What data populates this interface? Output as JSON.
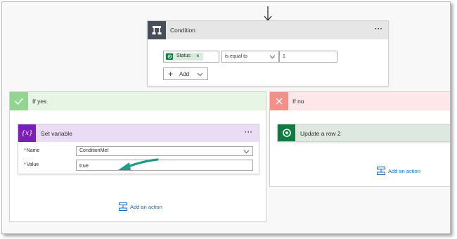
{
  "condition": {
    "title": "Condition",
    "more_label": "···",
    "token": {
      "label": "Status",
      "remove_label": "×",
      "icon": "dataverse-icon"
    },
    "operator": {
      "value": "is equal to"
    },
    "value": "1",
    "add_button_label": "Add"
  },
  "if_yes": {
    "title": "If yes",
    "set_variable": {
      "title": "Set variable",
      "icon_label": "{x}",
      "more_label": "···",
      "name_label": "Name",
      "name_value": "ConditionMet",
      "value_label": "Value",
      "value_value": "true",
      "required_mark": "*"
    },
    "add_action_label": "Add an action"
  },
  "if_no": {
    "title": "If no",
    "update_row": {
      "title": "Update a row 2"
    },
    "add_action_label": "Add an action"
  },
  "colors": {
    "condition_icon_bg": "#484f58",
    "yes_accent": "#92d490",
    "no_accent": "#f3908a",
    "variable_accent": "#7a1fb8",
    "dataverse_green": "#0f7b3f",
    "link_blue": "#0f6cbd",
    "annotation_arrow": "#1e9c88"
  }
}
